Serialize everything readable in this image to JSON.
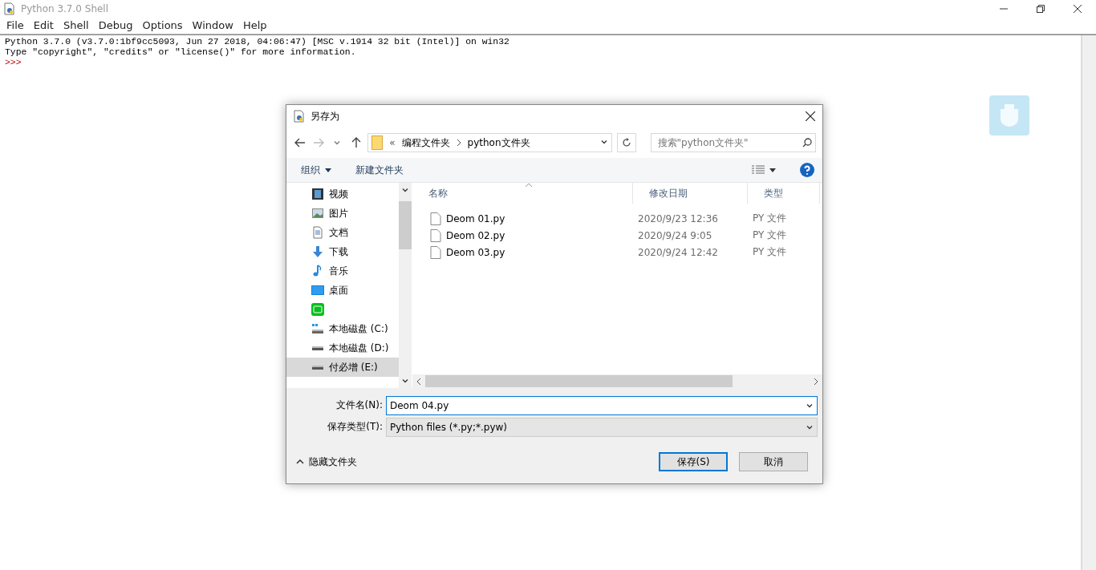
{
  "window": {
    "title": "Python 3.7.0 Shell"
  },
  "menu": [
    "File",
    "Edit",
    "Shell",
    "Debug",
    "Options",
    "Window",
    "Help"
  ],
  "shell": {
    "lines": [
      "Python 3.7.0 (v3.7.0:1bf9cc5093, Jun 27 2018, 04:06:47) [MSC v.1914 32 bit (Intel)] on win32",
      "Type \"copyright\", \"credits\" or \"license()\" for more information."
    ],
    "prompt": ">>>"
  },
  "dialog": {
    "title": "另存为",
    "breadcrumb": {
      "prefix": "«",
      "parts": [
        "编程文件夹",
        "python文件夹"
      ]
    },
    "search_placeholder": "搜索\"python文件夹\"",
    "toolbar": {
      "organize": "组织",
      "new_folder": "新建文件夹"
    },
    "nav_items": [
      {
        "label": "视频",
        "kind": "video",
        "selected": false
      },
      {
        "label": "图片",
        "kind": "image",
        "selected": false
      },
      {
        "label": "文档",
        "kind": "doc",
        "selected": false
      },
      {
        "label": "下载",
        "kind": "download",
        "selected": false
      },
      {
        "label": "音乐",
        "kind": "music",
        "selected": false
      },
      {
        "label": "桌面",
        "kind": "desktop",
        "selected": false
      },
      {
        "kind": "app",
        "selected": false
      },
      {
        "label": "本地磁盘 (C:)",
        "kind": "sysdrive",
        "selected": false
      },
      {
        "label": "本地磁盘 (D:)",
        "kind": "drive",
        "selected": false
      },
      {
        "label": "付必增 (E:)",
        "kind": "drive",
        "selected": true
      }
    ],
    "columns": [
      "名称",
      "修改日期",
      "类型"
    ],
    "files": [
      {
        "name": "Deom 01.py",
        "modified": "2020/9/23 12:36",
        "type": "PY 文件"
      },
      {
        "name": "Deom 02.py",
        "modified": "2020/9/24 9:05",
        "type": "PY 文件"
      },
      {
        "name": "Deom 03.py",
        "modified": "2020/9/24 12:42",
        "type": "PY 文件"
      }
    ],
    "filename_label": "文件名(N):",
    "filename": "Deom 04.py",
    "filetype_label": "保存类型(T):",
    "filetype": "Python files (*.py;*.pyw)",
    "hide_folders": "隐藏文件夹",
    "buttons": [
      {
        "label": "保存(S)",
        "default": true
      },
      {
        "label": "取消",
        "default": false
      }
    ]
  }
}
